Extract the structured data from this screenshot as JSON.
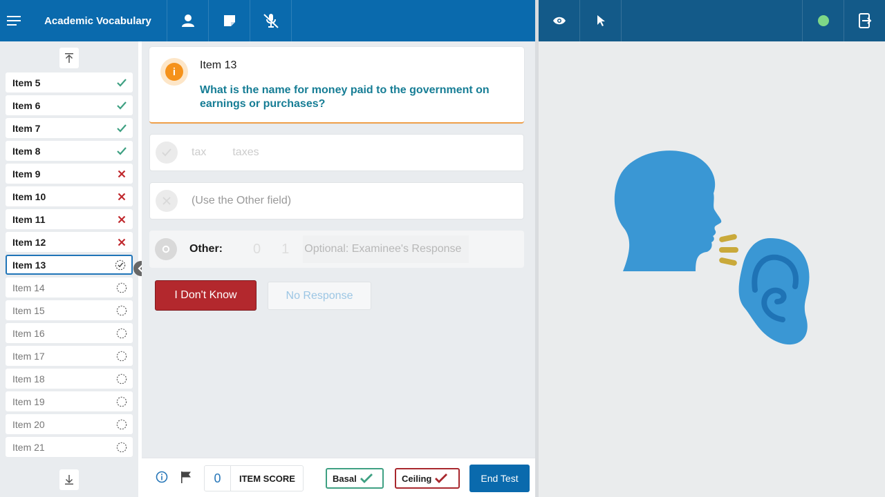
{
  "header": {
    "title": "Academic Vocabulary",
    "icons": [
      "menu-icon",
      "person-icon",
      "note-icon",
      "mic-off-icon"
    ],
    "right_icons": [
      "eye-icon",
      "pointer-icon",
      "status-dot",
      "exit-screen-icon"
    ],
    "status_color": "#7ed787"
  },
  "sidebar": {
    "items": [
      {
        "label": "Item 5",
        "status": "correct"
      },
      {
        "label": "Item 6",
        "status": "correct"
      },
      {
        "label": "Item 7",
        "status": "correct"
      },
      {
        "label": "Item 8",
        "status": "correct"
      },
      {
        "label": "Item 9",
        "status": "incorrect"
      },
      {
        "label": "Item 10",
        "status": "incorrect"
      },
      {
        "label": "Item 11",
        "status": "incorrect"
      },
      {
        "label": "Item 12",
        "status": "incorrect"
      },
      {
        "label": "Item 13",
        "status": "current"
      },
      {
        "label": "Item 14",
        "status": "pending"
      },
      {
        "label": "Item 15",
        "status": "pending"
      },
      {
        "label": "Item 16",
        "status": "pending"
      },
      {
        "label": "Item 17",
        "status": "pending"
      },
      {
        "label": "Item 18",
        "status": "pending"
      },
      {
        "label": "Item 19",
        "status": "pending"
      },
      {
        "label": "Item 20",
        "status": "pending"
      },
      {
        "label": "Item 21",
        "status": "pending"
      }
    ]
  },
  "question": {
    "item_label": "Item 13",
    "text": "What is the name for money paid to the government on earnings or purchases?"
  },
  "answers": {
    "correct_1": "tax",
    "correct_2": "taxes",
    "incorrect": "(Use the Other field)",
    "other_label": "Other:",
    "score_0": "0",
    "score_1": "1",
    "other_placeholder": "Optional: Examinee's Response"
  },
  "buttons": {
    "idk": "I Don't Know",
    "no_response": "No Response"
  },
  "footer": {
    "item_score_value": "0",
    "item_score_label": "ITEM SCORE",
    "basal": "Basal",
    "ceiling": "Ceiling",
    "end_test": "End Test"
  },
  "colors": {
    "primary": "#0a6aad",
    "question_text": "#167d95",
    "correct": "#3ea082",
    "incorrect": "#c0282d",
    "illustration": "#3a97d4",
    "sound_waves": "#c9a93a"
  }
}
